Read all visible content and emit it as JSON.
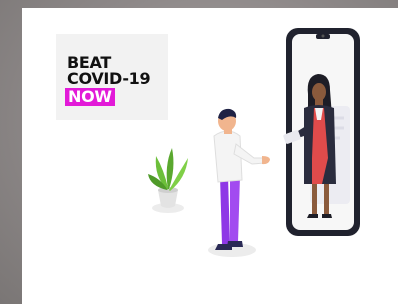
{
  "logo": {
    "line1": "BEAT",
    "line2": "COVID-19",
    "line3": "NOW",
    "accent_color": "#e21ad8"
  },
  "illustration": {
    "description_icons": [
      "phone-icon",
      "doctor-icon",
      "patient-icon",
      "plant-icon"
    ]
  }
}
